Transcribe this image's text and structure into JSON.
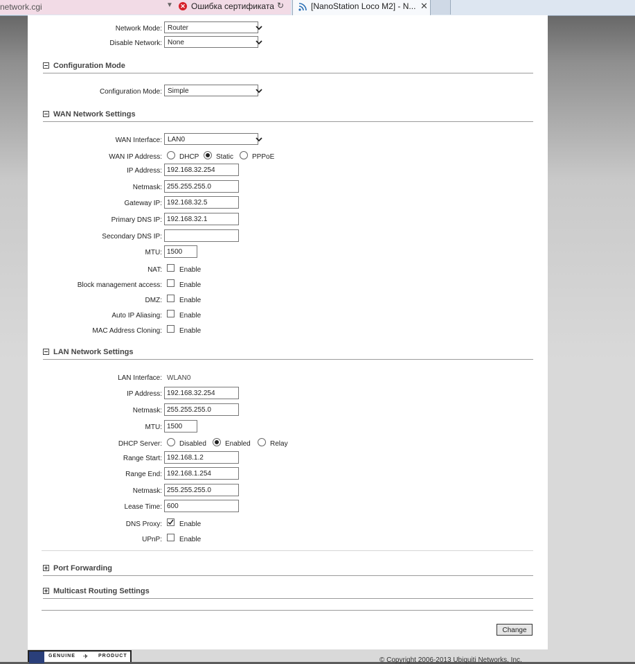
{
  "browser": {
    "url_fragment": "network.cgi",
    "cert_error": "Ошибка сертификата",
    "tab_title": "[NanoStation Loco M2] - N..."
  },
  "general": {
    "network_mode": {
      "label": "Network Mode:",
      "value": "Router"
    },
    "disable_network": {
      "label": "Disable Network:",
      "value": "None"
    }
  },
  "config_mode": {
    "section_title": "Configuration Mode",
    "label": "Configuration Mode:",
    "value": "Simple"
  },
  "wan": {
    "section_title": "WAN Network Settings",
    "interface": {
      "label": "WAN Interface:",
      "value": "LAN0"
    },
    "ip_mode": {
      "label": "WAN IP Address:",
      "options": [
        "DHCP",
        "Static",
        "PPPoE"
      ],
      "selected": "Static"
    },
    "ip_address": {
      "label": "IP Address:",
      "value": "192.168.32.254"
    },
    "netmask": {
      "label": "Netmask:",
      "value": "255.255.255.0"
    },
    "gateway": {
      "label": "Gateway IP:",
      "value": "192.168.32.5"
    },
    "primary_dns": {
      "label": "Primary DNS IP:",
      "value": "192.168.32.1"
    },
    "secondary_dns": {
      "label": "Secondary DNS IP:",
      "value": ""
    },
    "mtu": {
      "label": "MTU:",
      "value": "1500"
    },
    "nat": {
      "label": "NAT:",
      "option": "Enable",
      "checked": false
    },
    "block_mgmt": {
      "label": "Block management access:",
      "option": "Enable",
      "checked": false
    },
    "dmz": {
      "label": "DMZ:",
      "option": "Enable",
      "checked": false
    },
    "auto_ip": {
      "label": "Auto IP Aliasing:",
      "option": "Enable",
      "checked": false
    },
    "mac_clone": {
      "label": "MAC Address Cloning:",
      "option": "Enable",
      "checked": false
    }
  },
  "lan": {
    "section_title": "LAN Network Settings",
    "interface": {
      "label": "LAN Interface:",
      "value": "WLAN0"
    },
    "ip_address": {
      "label": "IP Address:",
      "value": "192.168.32.254"
    },
    "netmask": {
      "label": "Netmask:",
      "value": "255.255.255.0"
    },
    "mtu": {
      "label": "MTU:",
      "value": "1500"
    },
    "dhcp_server": {
      "label": "DHCP Server:",
      "options": [
        "Disabled",
        "Enabled",
        "Relay"
      ],
      "selected": "Enabled"
    },
    "range_start": {
      "label": "Range Start:",
      "value": "192.168.1.2"
    },
    "range_end": {
      "label": "Range End:",
      "value": "192.168.1.254"
    },
    "dhcp_netmask": {
      "label": "Netmask:",
      "value": "255.255.255.0"
    },
    "lease_time": {
      "label": "Lease Time:",
      "value": "600"
    },
    "dns_proxy": {
      "label": "DNS Proxy:",
      "option": "Enable",
      "checked": true
    },
    "upnp": {
      "label": "UPnP:",
      "option": "Enable",
      "checked": false
    }
  },
  "port_forwarding": {
    "section_title": "Port Forwarding"
  },
  "multicast": {
    "section_title": "Multicast Routing Settings"
  },
  "actions": {
    "change_label": "Change"
  },
  "footer": {
    "badge_left": "GENUINE",
    "badge_right": "PRODUCT",
    "copyright": "© Copyright 2006-2013 Ubiquiti Networks, Inc."
  }
}
